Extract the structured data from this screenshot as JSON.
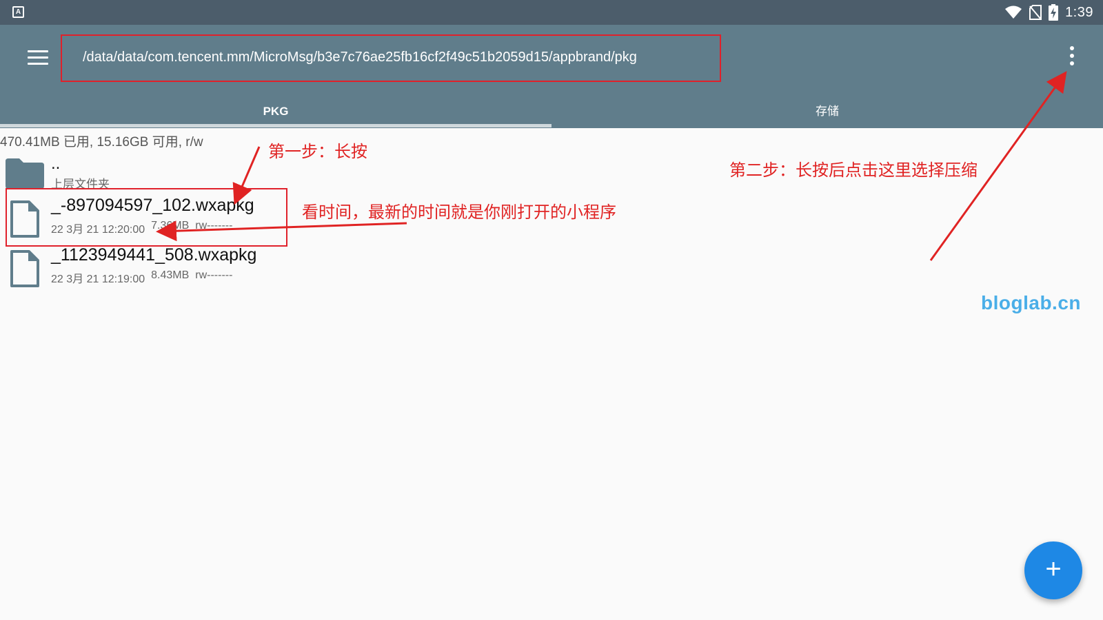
{
  "status_bar": {
    "app_icon": "A",
    "icons": [
      "wifi-icon",
      "no-sim-icon",
      "battery-charging-icon"
    ],
    "time": "1:39"
  },
  "app_bar": {
    "menu_icon": "menu-icon",
    "path": "/data/data/com.tencent.mm/MicroMsg/b3e7c76ae25fb16cf2f49c51b2059d15/appbrand/pkg",
    "overflow_icon": "more-vert-icon",
    "tabs": [
      {
        "label": "PKG",
        "selected": true
      },
      {
        "label": "存储",
        "selected": false
      }
    ]
  },
  "space_info": "470.41MB 已用, 15.16GB 可用, r/w",
  "files": [
    {
      "name": "..",
      "subtitle": "上层文件夹",
      "icon": "folder-icon"
    },
    {
      "name": "_-897094597_102.wxapkg",
      "date": "22 3月 21 12:20:00",
      "size": "7.36MB",
      "perms": "rw-------",
      "icon": "file-icon"
    },
    {
      "name": "_1123949441_508.wxapkg",
      "date": "22 3月 21 12:19:00",
      "size": "8.43MB",
      "perms": "rw-------",
      "icon": "file-icon"
    }
  ],
  "annotations": {
    "step1": "第一步：长按",
    "step2": "第二步：长按后点击这里选择压缩",
    "time_note": "看时间，最新的时间就是你刚打开的小程序",
    "color": "#e02323"
  },
  "watermark": "bloglab.cn",
  "fab": {
    "icon": "add-icon",
    "label": "+"
  },
  "colors": {
    "status_bar": "#4c5d6b",
    "app_bar": "#607d8b",
    "fab": "#1e88e5",
    "background": "#fafafa"
  }
}
